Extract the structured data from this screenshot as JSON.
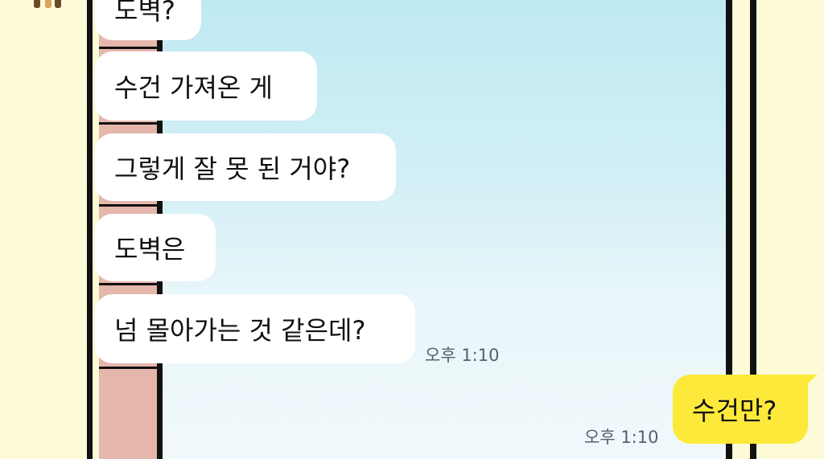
{
  "chat": {
    "messages": [
      {
        "from": "friend",
        "text": "도벽?"
      },
      {
        "from": "friend",
        "text": "수건 가져온 게"
      },
      {
        "from": "friend",
        "text": "그렇게 잘 못 된 거야?"
      },
      {
        "from": "friend",
        "text": "도벽은"
      },
      {
        "from": "friend",
        "text": "넘 몰아가는 것 같은데?"
      },
      {
        "from": "me",
        "text": "수건만?"
      }
    ],
    "timestamps": {
      "friend_last": "오후 1:10",
      "me_last": "오후 1:10"
    }
  },
  "colors": {
    "my_bubble": "#fde93a",
    "friend_bubble": "#ffffff",
    "chat_background": "#cfeef5",
    "page_background": "#fdfad8",
    "side_strip": "#e5b6ac"
  }
}
